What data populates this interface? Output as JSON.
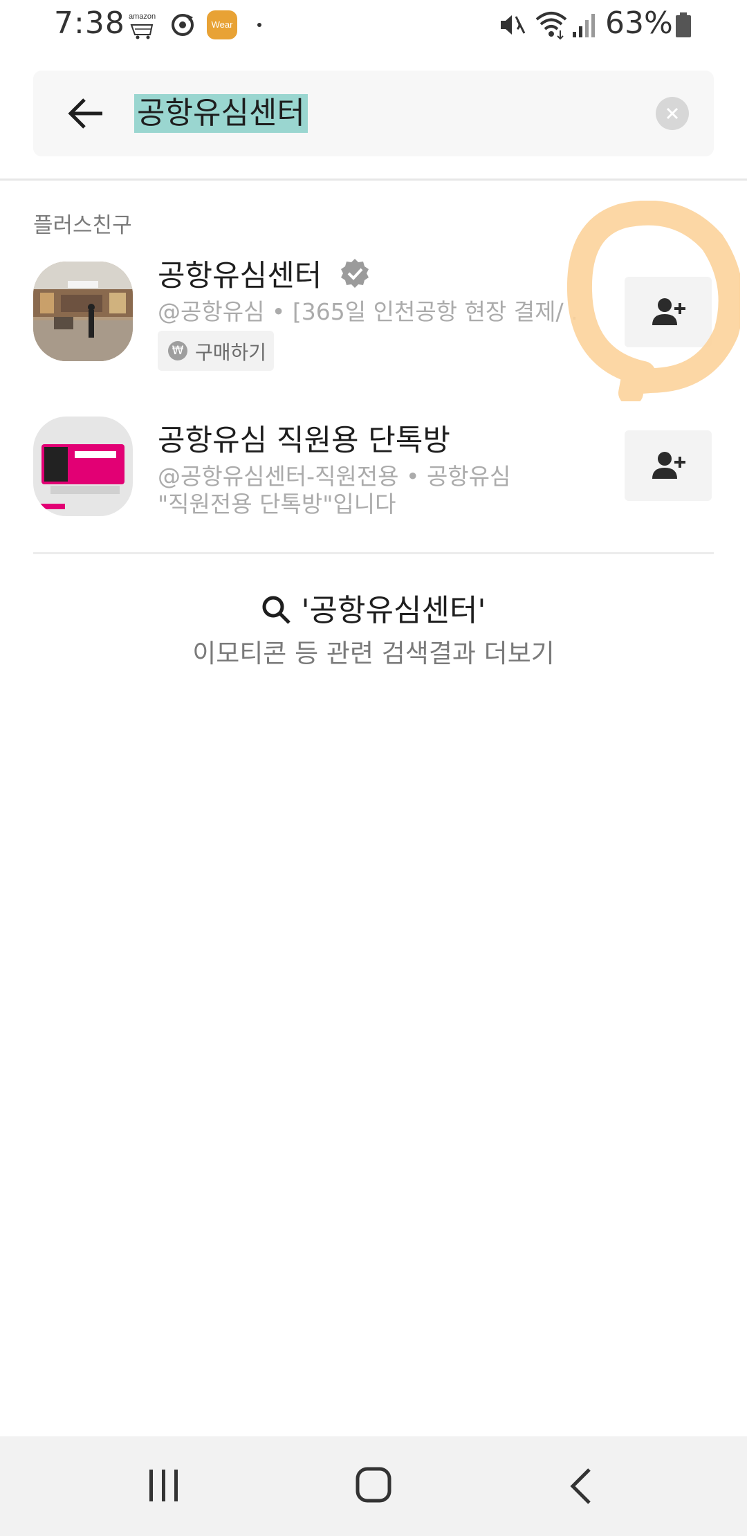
{
  "status_bar": {
    "time": "7:38",
    "amazon_label": "amazon",
    "wear_label": "Wear",
    "battery": "63%"
  },
  "search": {
    "query": "공항유심센터",
    "back_icon": "arrow-left-icon",
    "clear_icon": "clear-icon"
  },
  "section": {
    "label": "플러스친구"
  },
  "results": [
    {
      "title": "공항유심센터",
      "verified": true,
      "subtitle": "@공항유심 • [365일 인천공항 현장 결제/ ...",
      "chip_label": "구매하기",
      "chip_icon": "₩"
    },
    {
      "title": "공항유심 직원용 단톡방",
      "subtitle_line1": "@공항유심센터-직원전용 • 공항유심",
      "subtitle_line2": "\"직원전용 단톡방\"입니다"
    }
  ],
  "more": {
    "query": "'공항유심센터'",
    "label": "이모티콘 등 관련 검색결과 더보기"
  },
  "colors": {
    "search_highlight": "#9ad6d0",
    "annotation": "#fcd39b",
    "navbar": "#f2f2f2"
  }
}
